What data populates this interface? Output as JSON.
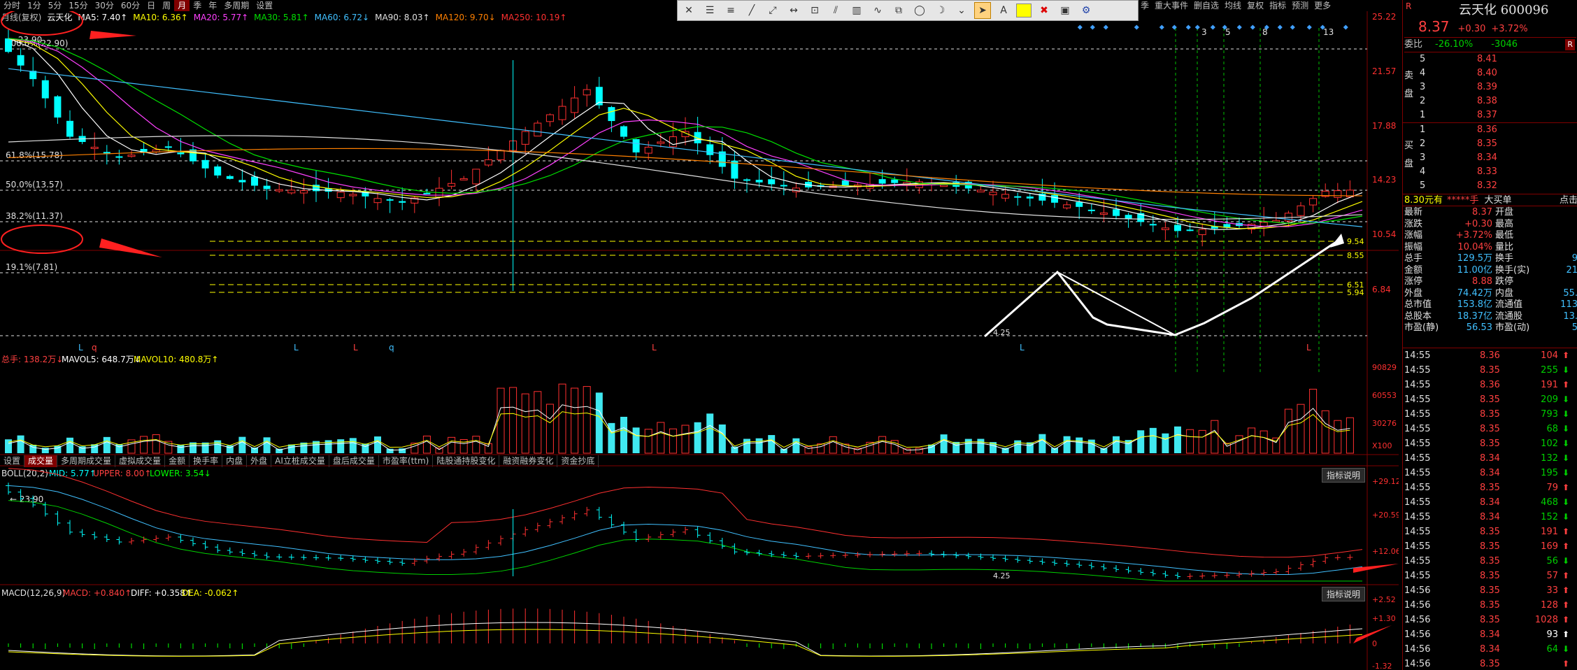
{
  "topbar": {
    "periods": [
      "分时",
      "1分",
      "5分",
      "15分",
      "30分",
      "60分",
      "日",
      "周",
      "月",
      "季",
      "年",
      "多周期",
      "设置"
    ],
    "active_period": "月"
  },
  "right_menu": [
    "季",
    "重大事件",
    "删自选",
    "均线",
    "复权",
    "指标",
    "预测",
    "更多"
  ],
  "legend": {
    "label": "月线(复权)",
    "name": "云天化",
    "items": [
      {
        "text": "MA5: 7.40↑",
        "color": "#ffffff"
      },
      {
        "text": "MA10: 6.36↑",
        "color": "#ffff00"
      },
      {
        "text": "MA20: 5.77↑",
        "color": "#ff40ff"
      },
      {
        "text": "MA30: 5.81↑",
        "color": "#00e000"
      },
      {
        "text": "MA60: 6.72↓",
        "color": "#40c0ff"
      },
      {
        "text": "MA90: 8.03↑",
        "color": "#e0e0e0"
      },
      {
        "text": "MA120: 9.70↓",
        "color": "#ff8000"
      },
      {
        "text": "MA250: 10.19↑",
        "color": "#ff3030"
      }
    ]
  },
  "price_panel": {
    "y_labels": [
      "25.22",
      "21.57",
      "17.88",
      "14.23",
      "10.54",
      "6.84"
    ],
    "fib_levels": [
      "100.0%(22.90)",
      "61.8%(15.78)",
      "50.0%(13.57)",
      "38.2%(11.37)",
      "19.1%(7.81)"
    ],
    "high_mark": "23.90",
    "low_mark": "4.25",
    "right_marks": [
      "9.54",
      "8.55",
      "6.51",
      "5.94"
    ],
    "signal_numbers": [
      "3",
      "5",
      "8",
      "13"
    ],
    "bottom_letters": [
      "L",
      "q",
      "L",
      "L",
      "q",
      "L",
      "L",
      "L"
    ]
  },
  "volume_panel": {
    "label": "总手: 138.2万↓",
    "mavol5": "MAVOL5: 648.7万↓",
    "mavol10": "MAVOL10: 480.8万↑",
    "y_labels": [
      "90829",
      "60553",
      "30276",
      "X100"
    ]
  },
  "tabs": [
    "设置",
    "成交量",
    "多周期成交量",
    "虚拟成交量",
    "金额",
    "换手率",
    "内盘",
    "外盘",
    "AI立桩成交量",
    "盘后成交量",
    "市盈率(ttm)",
    "陆股通持股变化",
    "融资融券变化",
    "资金抄底"
  ],
  "active_tab": "成交量",
  "boll_panel": {
    "label": "BOLL(20,2)",
    "mid": "MID: 5.77↑",
    "upper": "UPPER: 8.00↑",
    "lower": "LOWER: 3.54↓",
    "high_mark": "23.90",
    "low_mark": "4.25",
    "y_labels": [
      "+29.12",
      "+20.59",
      "+12.06"
    ],
    "help": "指标说明"
  },
  "macd_panel": {
    "label": "MACD(12,26,9)",
    "macd": "MACD: +0.840↑",
    "diff": "DIFF: +0.358↑",
    "dea": "DEA: -0.062↑",
    "y_labels": [
      "+2.52",
      "+1.30",
      "0",
      "-1.32"
    ],
    "help": "指标说明"
  },
  "quote": {
    "title": "云天化 600096",
    "price": "8.37",
    "change": "+0.30",
    "change_pct": "+3.72%",
    "weibi_label": "委比",
    "weibi": "-26.10%",
    "weicha": "-3046",
    "right_tag": "R",
    "sells": [
      {
        "n": "5",
        "price": "8.41"
      },
      {
        "n": "4",
        "price": "8.40"
      },
      {
        "n": "3",
        "price": "8.39"
      },
      {
        "n": "2",
        "price": "8.38"
      },
      {
        "n": "1",
        "price": "8.37"
      }
    ],
    "buys": [
      {
        "n": "1",
        "price": "8.36"
      },
      {
        "n": "2",
        "price": "8.35"
      },
      {
        "n": "3",
        "price": "8.34"
      },
      {
        "n": "4",
        "price": "8.33"
      },
      {
        "n": "5",
        "price": "8.32"
      }
    ],
    "sell_side": "卖盘",
    "buy_side": "买盘",
    "bigorder": {
      "left": "8.30元有",
      "mid": "*****手",
      "label": "大买单",
      "right": "点击"
    },
    "stats": [
      [
        "最新",
        "8.37",
        "开盘",
        ""
      ],
      [
        "涨跌",
        "+0.30",
        "最高",
        ""
      ],
      [
        "涨幅",
        "+3.72%",
        "最低",
        ""
      ],
      [
        "振幅",
        "10.04%",
        "量比",
        ""
      ],
      [
        "总手",
        "129.5万",
        "换手",
        "9"
      ],
      [
        "金额",
        "11.00亿",
        "换手(实)",
        "21"
      ],
      [
        "涨停",
        "8.88",
        "跌停",
        ""
      ],
      [
        "外盘",
        "74.42万",
        "内盘",
        "55."
      ],
      [
        "总市值",
        "153.8亿",
        "流通值",
        "113"
      ],
      [
        "总股本",
        "18.37亿",
        "流通股",
        "13."
      ],
      [
        "市盈(静)",
        "56.53",
        "市盈(动)",
        "5"
      ]
    ],
    "ticks": [
      {
        "time": "14:55",
        "price": "8.36",
        "vol": "104",
        "dir": "up"
      },
      {
        "time": "14:55",
        "price": "8.35",
        "vol": "255",
        "dir": "down"
      },
      {
        "time": "14:55",
        "price": "8.36",
        "vol": "191",
        "dir": "up"
      },
      {
        "time": "14:55",
        "price": "8.35",
        "vol": "209",
        "dir": "down"
      },
      {
        "time": "14:55",
        "price": "8.35",
        "vol": "793",
        "dir": "down"
      },
      {
        "time": "14:55",
        "price": "8.35",
        "vol": "68",
        "dir": "down"
      },
      {
        "time": "14:55",
        "price": "8.35",
        "vol": "102",
        "dir": "down"
      },
      {
        "time": "14:55",
        "price": "8.34",
        "vol": "132",
        "dir": "down"
      },
      {
        "time": "14:55",
        "price": "8.34",
        "vol": "195",
        "dir": "down"
      },
      {
        "time": "14:55",
        "price": "8.35",
        "vol": "79",
        "dir": "up"
      },
      {
        "time": "14:55",
        "price": "8.34",
        "vol": "468",
        "dir": "down"
      },
      {
        "time": "14:55",
        "price": "8.34",
        "vol": "152",
        "dir": "down"
      },
      {
        "time": "14:55",
        "price": "8.35",
        "vol": "191",
        "dir": "up"
      },
      {
        "time": "14:55",
        "price": "8.35",
        "vol": "169",
        "dir": "up"
      },
      {
        "time": "14:55",
        "price": "8.35",
        "vol": "56",
        "dir": "down"
      },
      {
        "time": "14:55",
        "price": "8.35",
        "vol": "57",
        "dir": "up"
      },
      {
        "time": "14:56",
        "price": "8.35",
        "vol": "33",
        "dir": "up"
      },
      {
        "time": "14:56",
        "price": "8.35",
        "vol": "128",
        "dir": "up"
      },
      {
        "time": "14:56",
        "price": "8.35",
        "vol": "1028",
        "dir": "up"
      },
      {
        "time": "14:56",
        "price": "8.34",
        "vol": "93",
        "dir": "upw"
      },
      {
        "time": "14:56",
        "price": "8.34",
        "vol": "64",
        "dir": "down"
      },
      {
        "time": "14:56",
        "price": "8.35",
        "vol": "",
        "dir": "up"
      }
    ]
  },
  "colors": {
    "up": "#ff3030",
    "down": "#00ffff",
    "background": "#000000",
    "accent": "#800000"
  }
}
